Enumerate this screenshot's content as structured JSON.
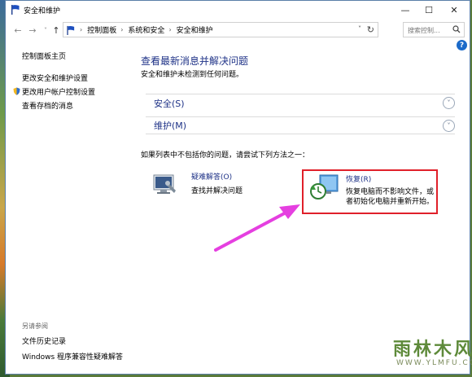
{
  "window": {
    "title": "安全和维护",
    "minimize_glyph": "—",
    "maximize_glyph": "☐",
    "close_glyph": "✕"
  },
  "address": {
    "back_glyph": "←",
    "forward_glyph": "→",
    "history_glyph": "˅",
    "up_glyph": "↑",
    "crumbs": [
      "控制面板",
      "系统和安全",
      "安全和维护"
    ],
    "separator": "›",
    "dropdown_glyph": "˅",
    "refresh_glyph": "↻",
    "search_placeholder": "搜索控制...",
    "search_icon": "search-icon"
  },
  "help_label": "?",
  "sidebar": {
    "home": "控制面板主页",
    "links": [
      "更改安全和维护设置",
      "更改用户帐户控制设置",
      "查看存档的消息"
    ],
    "see_also_heading": "另请参阅",
    "see_also": [
      "文件历史记录",
      "Windows 程序兼容性疑难解答"
    ]
  },
  "main": {
    "title": "查看最新消息并解决问题",
    "subtitle": "安全和维护未检测到任何问题。",
    "groups": [
      {
        "label": "安全(S)",
        "chevron": "˅"
      },
      {
        "label": "维护(M)",
        "chevron": "˅"
      }
    ],
    "hint": "如果列表中不包括你的问题，请尝试下列方法之一：",
    "tasks": [
      {
        "title": "疑难解答(O)",
        "desc": [
          "查找并解决问题"
        ],
        "icon": "troubleshoot-icon"
      },
      {
        "title": "恢复(R)",
        "desc": [
          "恢复电脑而不影响文件，或",
          "者初始化电脑并重新开始。"
        ],
        "icon": "recovery-icon"
      }
    ]
  },
  "annotation_colors": {
    "highlight": "#e0202a",
    "arrow": "#e53fe0"
  },
  "watermark": {
    "big": "雨林木风",
    "small": "WWW.YLMFU.COM"
  }
}
